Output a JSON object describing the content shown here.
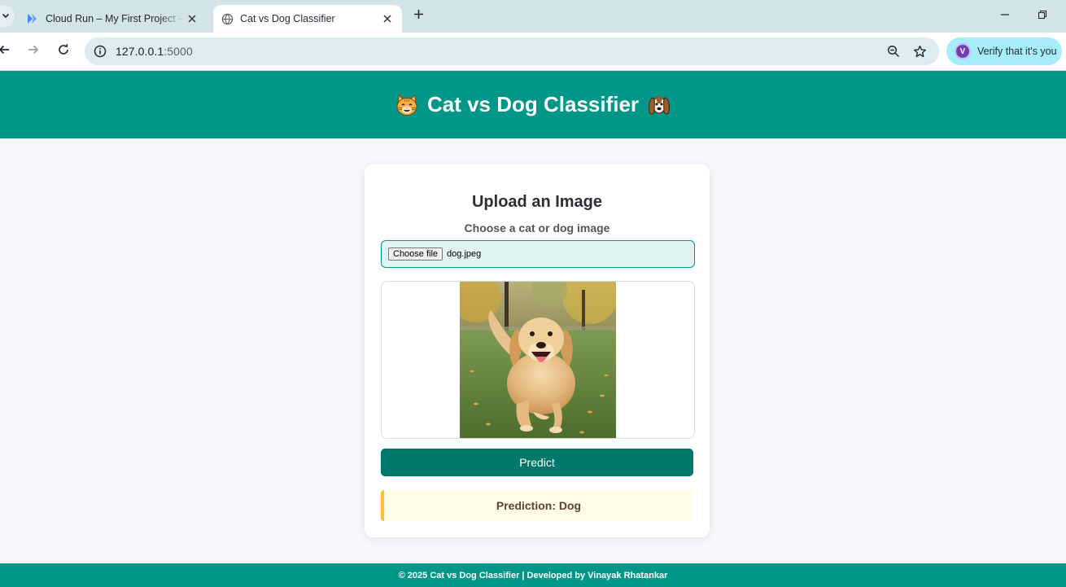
{
  "browser": {
    "tabs": [
      {
        "title": "Cloud Run – My First Project – Google Cloud console",
        "active": false,
        "icon": "cloud-run-icon"
      },
      {
        "title": "Cat vs Dog Classifier",
        "active": true,
        "icon": "globe-icon"
      }
    ],
    "address": {
      "host": "127.0.0.1",
      "port": ":5000"
    },
    "verify_label": "Verify that it's you",
    "profile_initial": "V"
  },
  "page": {
    "header_title": "Cat vs Dog Classifier",
    "header_left_icon": "cat-face-icon",
    "header_right_icon": "dog-face-icon",
    "upload_heading": "Upload an Image",
    "choose_label": "Choose a cat or dog image",
    "file_button": "Choose file",
    "file_name": "dog.jpeg",
    "preview_alt": "Uploaded dog photo preview",
    "predict_label": "Predict",
    "prediction_text": "Prediction: Dog",
    "footer_prefix": "© 2025 Cat vs Dog Classifier | Developed by ",
    "footer_author": "Vinayak Rhatankar"
  },
  "colors": {
    "primary": "#009688",
    "button": "#00796b",
    "input_bg": "#e0f2f1",
    "result_bg": "#fffde7",
    "result_accent": "#fbc02d"
  }
}
